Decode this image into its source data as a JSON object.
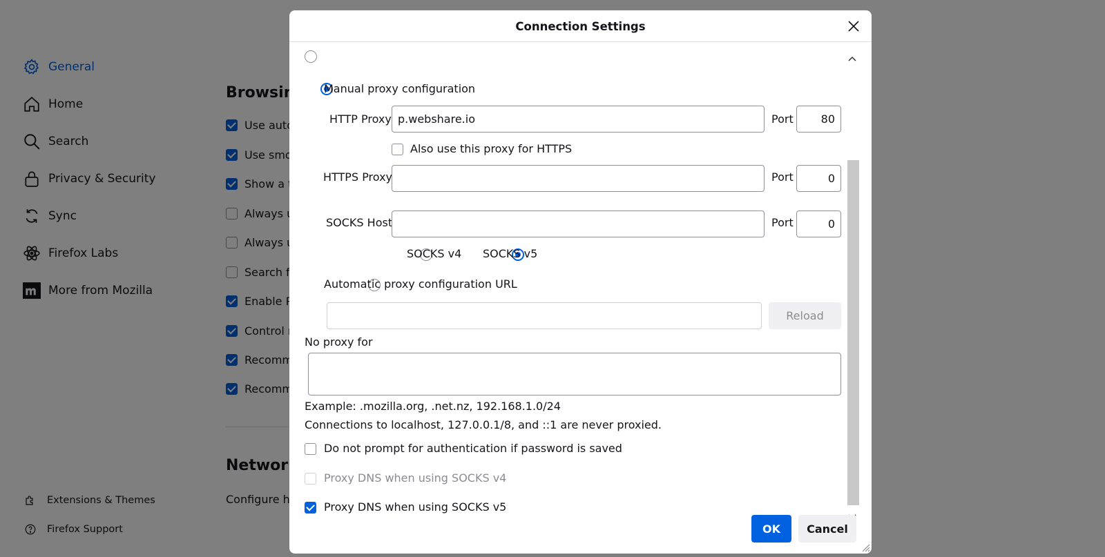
{
  "sidebar": {
    "items": [
      {
        "label": "General",
        "icon": "gear-icon",
        "active": true
      },
      {
        "label": "Home",
        "icon": "home-icon"
      },
      {
        "label": "Search",
        "icon": "search-icon"
      },
      {
        "label": "Privacy & Security",
        "icon": "lock-icon"
      },
      {
        "label": "Sync",
        "icon": "sync-icon"
      },
      {
        "label": "Firefox Labs",
        "icon": "labs-icon"
      },
      {
        "label": "More from Mozilla",
        "icon": "mozilla-icon"
      }
    ],
    "footer": [
      {
        "label": "Extensions & Themes",
        "icon": "puzzle-icon"
      },
      {
        "label": "Firefox Support",
        "icon": "help-icon"
      }
    ]
  },
  "main": {
    "browsing_title": "Browsing",
    "rows": [
      {
        "label": "Use auto",
        "checked": true
      },
      {
        "label": "Use smo",
        "checked": true
      },
      {
        "label": "Show a t",
        "checked": true
      },
      {
        "label": "Always u",
        "checked": false
      },
      {
        "label": "Always u",
        "checked": false
      },
      {
        "label": "Search fo",
        "checked": false
      },
      {
        "label": "Enable P",
        "checked": true
      },
      {
        "label": "Control r",
        "checked": true
      },
      {
        "label": "Recomm",
        "checked": true
      },
      {
        "label": "Recomm",
        "checked": true
      }
    ],
    "network_title": "Network",
    "network_desc": "Configure ho"
  },
  "dialog": {
    "title": "Connection Settings",
    "manual_label": "Manual proxy configuration",
    "http_proxy_label": "HTTP Proxy",
    "http_proxy_value": "p.webshare.io",
    "port_label": "Port",
    "http_port": "80",
    "also_https_label": "Also use this proxy for HTTPS",
    "https_proxy_label": "HTTPS Proxy",
    "https_proxy_value": "",
    "https_port": "0",
    "socks_host_label": "SOCKS Host",
    "socks_host_value": "",
    "socks_port": "0",
    "socks_v4_label": "SOCKS v4",
    "socks_v5_label": "SOCKS v5",
    "auto_url_label": "Automatic proxy configuration URL",
    "reload_label": "Reload",
    "no_proxy_label": "No proxy for",
    "example_text": "Example: .mozilla.org, .net.nz, 192.168.1.0/24",
    "localhost_text": "Connections to localhost, 127.0.0.1/8, and ::1 are never proxied.",
    "no_prompt_label": "Do not prompt for authentication if password is saved",
    "dns_v4_label": "Proxy DNS when using SOCKS v4",
    "dns_v5_label": "Proxy DNS when using SOCKS v5",
    "ok_label": "OK",
    "cancel_label": "Cancel"
  },
  "colors": {
    "accent": "#0061e0",
    "overlay": "rgba(0,0,0,0.5)"
  }
}
